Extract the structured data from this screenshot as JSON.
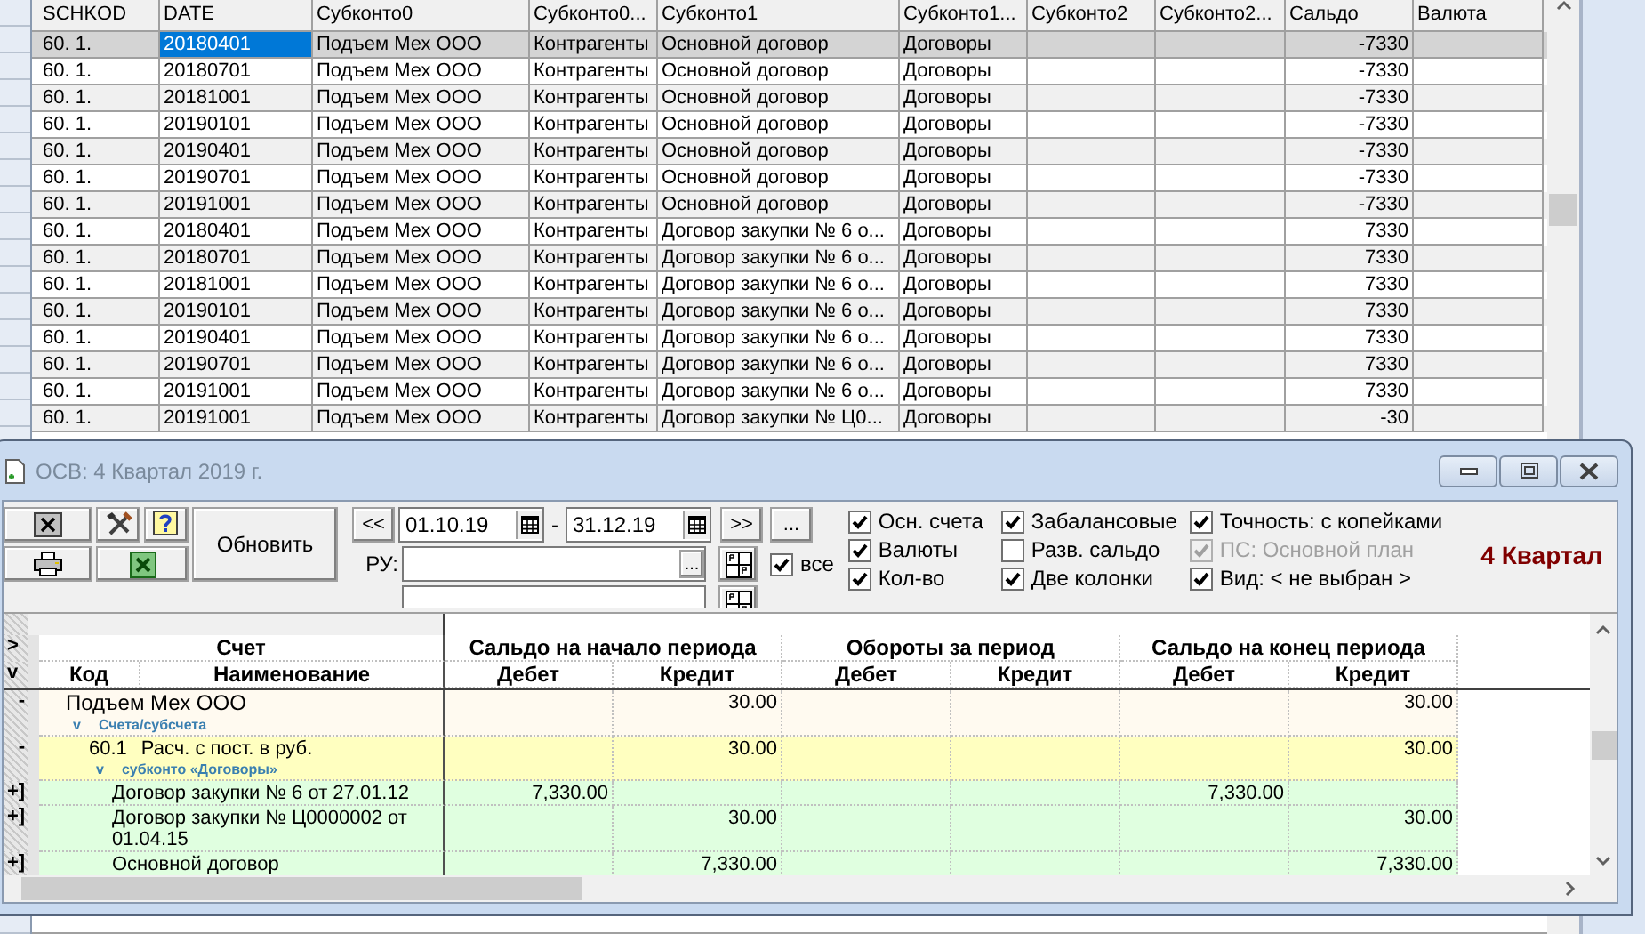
{
  "grid": {
    "columns": [
      "SCHKOD",
      "DATE",
      "Субконто0",
      "Субконто0...",
      "Субконто1",
      "Субконто1...",
      "Субконто2",
      "Субконто2...",
      "Сальдо",
      "Валюта"
    ],
    "rows": [
      {
        "selected": true,
        "cells": [
          "60. 1.",
          {
            "text": "20180401",
            "focused": true
          },
          "Подъем Мех ООО",
          "Контрагенты",
          "Основной договор",
          "Договоры",
          null,
          null,
          "-7330",
          null
        ]
      },
      {
        "selected": false,
        "cells": [
          "60. 1.",
          "20180701",
          "Подъем Мех ООО",
          "Контрагенты",
          "Основной договор",
          "Договоры",
          null,
          null,
          "-7330",
          null
        ]
      },
      {
        "selected": false,
        "cells": [
          "60. 1.",
          "20181001",
          "Подъем Мех ООО",
          "Контрагенты",
          "Основной договор",
          "Договоры",
          null,
          null,
          "-7330",
          null
        ]
      },
      {
        "selected": false,
        "cells": [
          "60. 1.",
          "20190101",
          "Подъем Мех ООО",
          "Контрагенты",
          "Основной договор",
          "Договоры",
          null,
          null,
          "-7330",
          null
        ]
      },
      {
        "selected": false,
        "cells": [
          "60. 1.",
          "20190401",
          "Подъем Мех ООО",
          "Контрагенты",
          "Основной договор",
          "Договоры",
          null,
          null,
          "-7330",
          null
        ]
      },
      {
        "selected": false,
        "cells": [
          "60. 1.",
          "20190701",
          "Подъем Мех ООО",
          "Контрагенты",
          "Основной договор",
          "Договоры",
          null,
          null,
          "-7330",
          null
        ]
      },
      {
        "selected": false,
        "cells": [
          "60. 1.",
          "20191001",
          "Подъем Мех ООО",
          "Контрагенты",
          "Основной договор",
          "Договоры",
          null,
          null,
          "-7330",
          null
        ]
      },
      {
        "selected": false,
        "cells": [
          "60. 1.",
          "20180401",
          "Подъем Мех ООО",
          "Контрагенты",
          "Договор закупки № 6 о...",
          "Договоры",
          null,
          null,
          "7330",
          null
        ]
      },
      {
        "selected": false,
        "cells": [
          "60. 1.",
          "20180701",
          "Подъем Мех ООО",
          "Контрагенты",
          "Договор закупки № 6 о...",
          "Договоры",
          null,
          null,
          "7330",
          null
        ]
      },
      {
        "selected": false,
        "cells": [
          "60. 1.",
          "20181001",
          "Подъем Мех ООО",
          "Контрагенты",
          "Договор закупки № 6 о...",
          "Договоры",
          null,
          null,
          "7330",
          null
        ]
      },
      {
        "selected": false,
        "cells": [
          "60. 1.",
          "20190101",
          "Подъем Мех ООО",
          "Контрагенты",
          "Договор закупки № 6 о...",
          "Договоры",
          null,
          null,
          "7330",
          null
        ]
      },
      {
        "selected": false,
        "cells": [
          "60. 1.",
          "20190401",
          "Подъем Мех ООО",
          "Контрагенты",
          "Договор закупки № 6 о...",
          "Договоры",
          null,
          null,
          "7330",
          null
        ]
      },
      {
        "selected": false,
        "cells": [
          "60. 1.",
          "20190701",
          "Подъем Мех ООО",
          "Контрагенты",
          "Договор закупки № 6 о...",
          "Договоры",
          null,
          null,
          "7330",
          null
        ]
      },
      {
        "selected": false,
        "cells": [
          "60. 1.",
          "20191001",
          "Подъем Мех ООО",
          "Контрагенты",
          "Договор закупки № 6 о...",
          "Договоры",
          null,
          null,
          "7330",
          null
        ]
      },
      {
        "selected": false,
        "cells": [
          "60. 1.",
          "20191001",
          "Подъем Мех ООО",
          "Контрагенты",
          "Договор закупки № Ц0...",
          "Договоры",
          null,
          null,
          "-30",
          null
        ]
      }
    ]
  },
  "dialog": {
    "title": "ОСВ: 4 Квартал 2019 г.",
    "toolbar": {
      "refresh_button": "Обновить",
      "prev_button": "<<",
      "date_from": "01.10.19",
      "date_separator": "-",
      "date_to": "31.12.19",
      "next_button": ">>",
      "more_button": "...",
      "ru_label": "РУ:",
      "ru_browse_button": "...",
      "ru_all": {
        "label": "все",
        "checked": true
      }
    },
    "options": [
      {
        "label": "Осн. счета",
        "checked": true,
        "disabled": false
      },
      {
        "label": "Валюты",
        "checked": true,
        "disabled": false
      },
      {
        "label": "Кол-во",
        "checked": true,
        "disabled": false
      },
      {
        "label": "Забалансовые",
        "checked": true,
        "disabled": false
      },
      {
        "label": "Разв. сальдо",
        "checked": false,
        "disabled": false
      },
      {
        "label": "Две колонки",
        "checked": true,
        "disabled": false
      },
      {
        "label": "Точность: с копейками",
        "checked": true,
        "disabled": false
      },
      {
        "label": "ПС: Основной план",
        "checked": true,
        "disabled": true
      },
      {
        "label": "Вид: < не выбран >",
        "checked": true,
        "disabled": false
      }
    ],
    "period_label": "4 Квартал",
    "tree": {
      "header_markers": [
        ">",
        "v"
      ],
      "header_groups": [
        "Счет",
        "Сальдо на начало периода",
        "Обороты за период",
        "Сальдо на конец периода"
      ],
      "header_columns": [
        "Код",
        "Наименование",
        "Дебет",
        "Кредит",
        "Дебет",
        "Кредит",
        "Дебет",
        "Кредит"
      ],
      "rows": [
        {
          "marker": "-",
          "name": "Подъем Мех ООО",
          "toggle": "v",
          "sublabel": "Счета/субсчета",
          "start_credit": "30.00",
          "end_credit": "30.00",
          "children": [
            {
              "marker": "-",
              "code": "60.1",
              "name": "Расч. с пост. в руб.",
              "toggle": "v",
              "sublabel": "субконто «Договоры»",
              "start_credit": "30.00",
              "end_credit": "30.00",
              "children": [
                {
                  "marker": "+]",
                  "name": "Договор закупки № 6 от 27.01.12",
                  "start_debit": "7,330.00",
                  "end_debit": "7,330.00"
                },
                {
                  "marker": "+]",
                  "name": "Договор закупки № Ц0000002 от 01.04.15",
                  "start_credit": "30.00",
                  "end_credit": "30.00"
                },
                {
                  "marker": "+]",
                  "name": "Основной договор",
                  "start_credit": "7,330.00",
                  "end_credit": "7,330.00"
                }
              ]
            }
          ]
        }
      ]
    }
  }
}
